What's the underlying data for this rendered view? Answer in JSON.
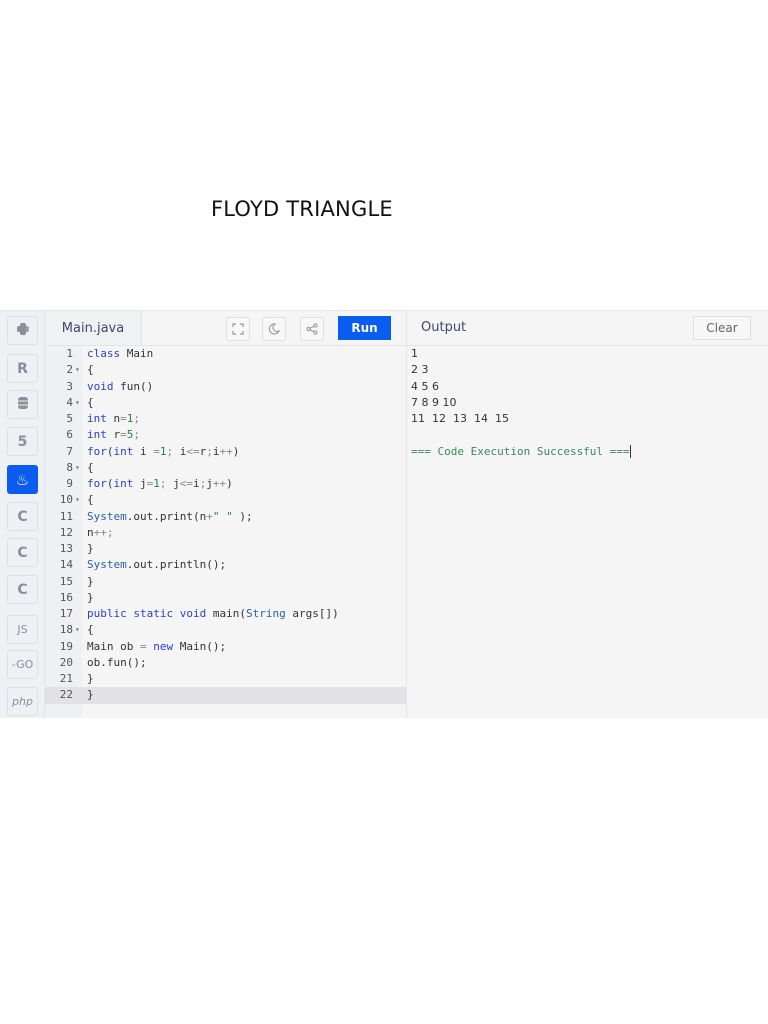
{
  "page_title": "FLOYD TRIANGLE",
  "sidebar": {
    "items": [
      {
        "name": "python",
        "label": ""
      },
      {
        "name": "r",
        "label": "R"
      },
      {
        "name": "sql",
        "label": ""
      },
      {
        "name": "html5",
        "label": "5"
      },
      {
        "name": "java",
        "label": ""
      },
      {
        "name": "c",
        "label": "C"
      },
      {
        "name": "cpp",
        "label": "C"
      },
      {
        "name": "csharp",
        "label": "C"
      },
      {
        "name": "javascript",
        "label": "JS"
      },
      {
        "name": "go",
        "label": "-GO"
      },
      {
        "name": "php",
        "label": "php"
      }
    ],
    "active": "java"
  },
  "editor": {
    "file_tab": "Main.java",
    "run_label": "Run",
    "lines": [
      {
        "n": "1",
        "fold": false,
        "seg": [
          [
            "class",
            "kw"
          ],
          [
            " Main",
            ""
          ]
        ]
      },
      {
        "n": "2",
        "fold": true,
        "seg": [
          [
            "{",
            ""
          ]
        ]
      },
      {
        "n": "3",
        "fold": false,
        "seg": [
          [
            "void",
            "kw"
          ],
          [
            " fun()",
            ""
          ]
        ]
      },
      {
        "n": "4",
        "fold": true,
        "seg": [
          [
            "{",
            ""
          ]
        ]
      },
      {
        "n": "5",
        "fold": false,
        "seg": [
          [
            "int",
            "kw"
          ],
          [
            " n",
            ""
          ],
          [
            "=",
            "op"
          ],
          [
            "1",
            "num-l"
          ],
          [
            ";",
            "op"
          ]
        ]
      },
      {
        "n": "6",
        "fold": false,
        "seg": [
          [
            "int",
            "kw"
          ],
          [
            " r",
            ""
          ],
          [
            "=",
            "op"
          ],
          [
            "5",
            "num-l"
          ],
          [
            ";",
            "op"
          ]
        ]
      },
      {
        "n": "7",
        "fold": false,
        "seg": [
          [
            "for",
            "kw"
          ],
          [
            "(",
            ""
          ],
          [
            "int",
            "kw"
          ],
          [
            " i ",
            ""
          ],
          [
            "=",
            "op"
          ],
          [
            "1",
            "num-l"
          ],
          [
            "; ",
            "op"
          ],
          [
            "i",
            ""
          ],
          [
            "<=",
            "op"
          ],
          [
            "r",
            ""
          ],
          [
            ";",
            "op"
          ],
          [
            "i",
            ""
          ],
          [
            "++",
            "op"
          ],
          [
            ")",
            ""
          ]
        ]
      },
      {
        "n": "8",
        "fold": true,
        "seg": [
          [
            "{",
            ""
          ]
        ]
      },
      {
        "n": "9",
        "fold": false,
        "seg": [
          [
            "for",
            "kw"
          ],
          [
            "(",
            ""
          ],
          [
            "int",
            "kw"
          ],
          [
            " j",
            ""
          ],
          [
            "=",
            "op"
          ],
          [
            "1",
            "num-l"
          ],
          [
            "; ",
            "op"
          ],
          [
            "j",
            ""
          ],
          [
            "<=",
            "op"
          ],
          [
            "i",
            ""
          ],
          [
            ";",
            "op"
          ],
          [
            "j",
            ""
          ],
          [
            "++",
            "op"
          ],
          [
            ")",
            ""
          ]
        ]
      },
      {
        "n": "10",
        "fold": true,
        "seg": [
          [
            "{",
            ""
          ]
        ]
      },
      {
        "n": "11",
        "fold": false,
        "seg": [
          [
            "System",
            "cls"
          ],
          [
            ".out.print(n",
            ""
          ],
          [
            "+",
            "op"
          ],
          [
            "\" \"",
            "str"
          ],
          [
            " );",
            ""
          ]
        ]
      },
      {
        "n": "12",
        "fold": false,
        "seg": [
          [
            "n",
            ""
          ],
          [
            "++;",
            "op"
          ]
        ]
      },
      {
        "n": "13",
        "fold": false,
        "seg": [
          [
            "}",
            ""
          ]
        ]
      },
      {
        "n": "14",
        "fold": false,
        "seg": [
          [
            "System",
            "cls"
          ],
          [
            ".out.println();",
            ""
          ]
        ]
      },
      {
        "n": "15",
        "fold": false,
        "seg": [
          [
            "}",
            ""
          ]
        ]
      },
      {
        "n": "16",
        "fold": false,
        "seg": [
          [
            "}",
            ""
          ]
        ]
      },
      {
        "n": "17",
        "fold": false,
        "seg": [
          [
            "public static void",
            "kw"
          ],
          [
            " main(",
            ""
          ],
          [
            "String",
            "cls"
          ],
          [
            " args[])",
            ""
          ]
        ]
      },
      {
        "n": "18",
        "fold": true,
        "seg": [
          [
            "{",
            ""
          ]
        ]
      },
      {
        "n": "19",
        "fold": false,
        "seg": [
          [
            "Main ob ",
            ""
          ],
          [
            "=",
            "op"
          ],
          [
            " ",
            ""
          ],
          [
            "new",
            "kw"
          ],
          [
            " Main();",
            ""
          ]
        ]
      },
      {
        "n": "20",
        "fold": false,
        "seg": [
          [
            "ob.fun();",
            ""
          ]
        ]
      },
      {
        "n": "21",
        "fold": false,
        "seg": [
          [
            "}",
            ""
          ]
        ]
      },
      {
        "n": "22",
        "fold": false,
        "seg": [
          [
            "}",
            ""
          ]
        ]
      }
    ]
  },
  "output": {
    "label": "Output",
    "clear_label": "Clear",
    "lines": [
      "1",
      "2 3",
      "4 5 6",
      "7 8 9 10",
      "11  12  13  14  15"
    ],
    "status": "=== Code Execution Successful ==="
  }
}
